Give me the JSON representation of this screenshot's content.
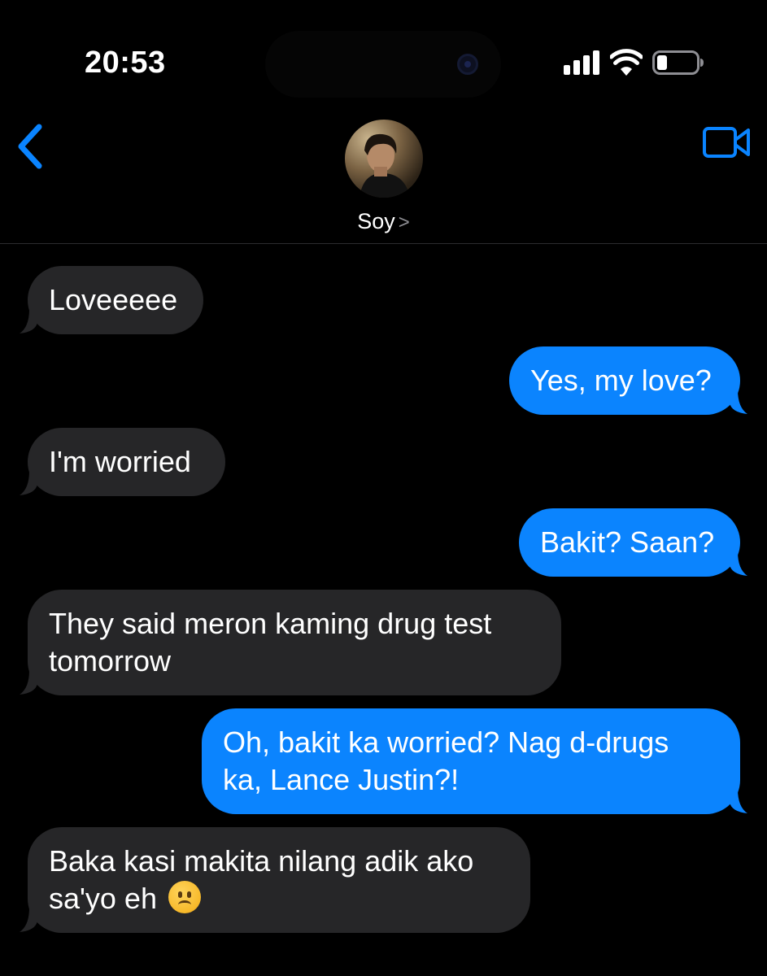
{
  "status_bar": {
    "time": "20:53",
    "signal_icon": "cellular-signal-icon",
    "wifi_icon": "wifi-icon",
    "battery_icon": "battery-low-icon",
    "battery_level": 0.25
  },
  "header": {
    "back_icon": "chevron-left-icon",
    "contact_name": "Soy",
    "contact_chevron": ">",
    "video_icon": "video-camera-icon"
  },
  "colors": {
    "background": "#000000",
    "incoming_bubble": "#262628",
    "outgoing_bubble": "#0b84fe",
    "accent": "#0a84ff"
  },
  "messages": [
    {
      "direction": "incoming",
      "lines": [
        "Loveeeee"
      ]
    },
    {
      "direction": "outgoing",
      "lines": [
        "Yes, my love?"
      ]
    },
    {
      "direction": "incoming",
      "lines": [
        "I'm worried"
      ]
    },
    {
      "direction": "outgoing",
      "lines": [
        "Bakit? Saan?"
      ]
    },
    {
      "direction": "incoming",
      "lines": [
        "They said meron kaming drug test",
        "tomorrow"
      ]
    },
    {
      "direction": "outgoing",
      "lines": [
        "Oh, bakit ka worried? Nag d-drugs",
        "ka, Lance Justin?!"
      ]
    },
    {
      "direction": "incoming",
      "lines": [
        "Baka kasi makita nilang adik ako",
        "sa'yo eh"
      ],
      "emoji": "frowning-face-emoji"
    }
  ]
}
